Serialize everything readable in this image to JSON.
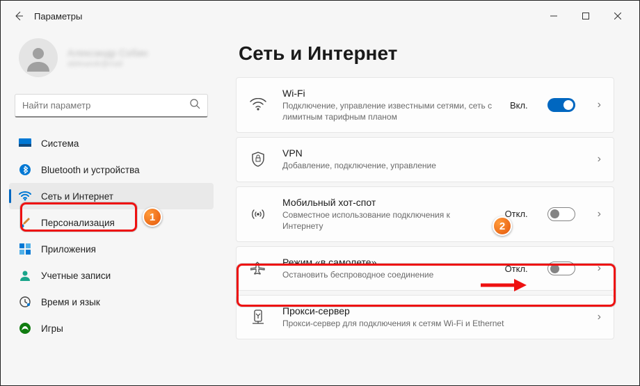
{
  "window": {
    "title": "Параметры"
  },
  "profile": {
    "name": "Александр Собин",
    "sub": "aleksandr@mail"
  },
  "search": {
    "placeholder": "Найти параметр"
  },
  "nav": {
    "items": [
      {
        "key": "system",
        "label": "Система"
      },
      {
        "key": "bluetooth",
        "label": "Bluetooth и устройства"
      },
      {
        "key": "network",
        "label": "Сеть и Интернет"
      },
      {
        "key": "personalization",
        "label": "Персонализация"
      },
      {
        "key": "apps",
        "label": "Приложения"
      },
      {
        "key": "accounts",
        "label": "Учетные записи"
      },
      {
        "key": "time",
        "label": "Время и язык"
      },
      {
        "key": "gaming",
        "label": "Игры"
      }
    ]
  },
  "page": {
    "title": "Сеть и Интернет"
  },
  "cards": {
    "wifi": {
      "title": "Wi-Fi",
      "desc": "Подключение, управление известными сетями, сеть с лимитным тарифным планом",
      "status": "Вкл.",
      "toggle": "on"
    },
    "vpn": {
      "title": "VPN",
      "desc": "Добавление, подключение, управление"
    },
    "hotspot": {
      "title": "Мобильный хот-спот",
      "desc": "Совместное использование подключения к Интернету",
      "status": "Откл.",
      "toggle": "off"
    },
    "airplane": {
      "title": "Режим «в самолете»",
      "desc": "Остановить беспроводное соединение",
      "status": "Откл.",
      "toggle": "off"
    },
    "proxy": {
      "title": "Прокси-сервер",
      "desc": "Прокси-сервер для подключения к сетям Wi-Fi и Ethernet"
    }
  },
  "annotations": {
    "badge1": "1",
    "badge2": "2"
  }
}
